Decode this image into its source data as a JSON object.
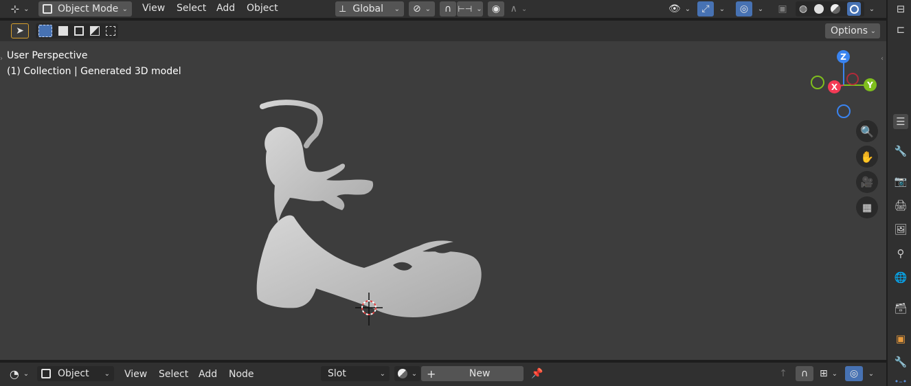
{
  "header": {
    "mode_label": "Object Mode",
    "menu": [
      "View",
      "Select",
      "Add",
      "Object"
    ],
    "orientation_label": "Global",
    "options_label": "Options"
  },
  "viewport": {
    "perspective_label": "User Perspective",
    "collection_label": "(1) Collection | Generated 3D model",
    "gizmo": {
      "z": "Z",
      "x": "X",
      "y": "Y"
    },
    "colors": {
      "background": "#3d3d3d",
      "model": "#c8c8c8",
      "x_axis": "#f43a55",
      "y_axis": "#7fbf1d",
      "z_axis": "#3a84f0"
    }
  },
  "shader_editor": {
    "editor_type_label": "Object",
    "menu": [
      "View",
      "Select",
      "Add",
      "Node"
    ],
    "slot_label": "Slot",
    "new_label": "New"
  },
  "icons": [
    "editor-type-icon",
    "object-mode-icon",
    "transform-orientation-icon",
    "pivot-icon",
    "snap-icon",
    "proportional-edit-icon",
    "visibility-icon",
    "gizmo-icon",
    "overlay-icon",
    "xray-icon",
    "shading-wireframe-icon",
    "shading-solid-icon",
    "shading-material-icon",
    "shading-rendered-icon",
    "zoom-icon",
    "pan-hand-icon",
    "camera-icon",
    "grid-icon",
    "pin-icon"
  ]
}
